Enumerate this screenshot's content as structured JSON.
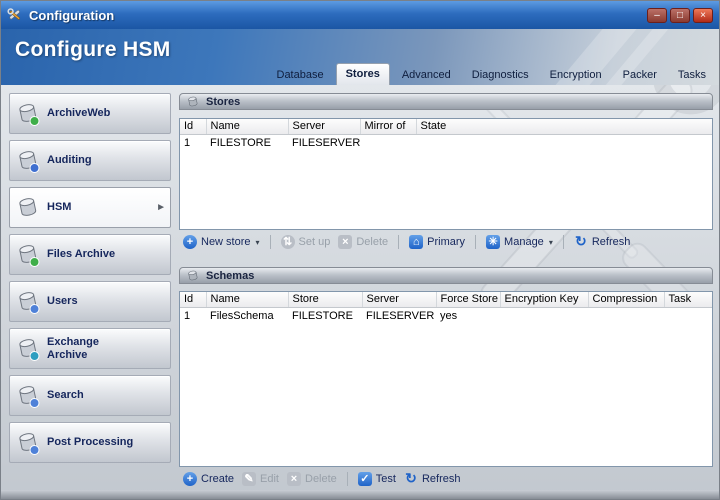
{
  "window": {
    "title": "Configuration"
  },
  "header": {
    "title": "Configure HSM"
  },
  "tabs": [
    {
      "label": "Database",
      "active": false
    },
    {
      "label": "Stores",
      "active": true
    },
    {
      "label": "Advanced",
      "active": false
    },
    {
      "label": "Diagnostics",
      "active": false
    },
    {
      "label": "Encryption",
      "active": false
    },
    {
      "label": "Packer",
      "active": false
    },
    {
      "label": "Tasks",
      "active": false
    }
  ],
  "sidebar": {
    "items": [
      {
        "label": "ArchiveWeb",
        "accent": "#3fae49"
      },
      {
        "label": "Auditing",
        "accent": "#3f6fd0"
      },
      {
        "label": "HSM",
        "accent": "#8d949e"
      },
      {
        "label": "Files Archive",
        "accent": "#3fae49"
      },
      {
        "label": "Users",
        "accent": "#4f81d8"
      },
      {
        "label": "Exchange\nArchive",
        "accent": "#2e9ec0"
      },
      {
        "label": "Search",
        "accent": "#4f81d8"
      },
      {
        "label": "Post Processing",
        "accent": "#4f81d8"
      }
    ]
  },
  "stores": {
    "title": "Stores",
    "columns": [
      "Id",
      "Name",
      "Server",
      "Mirror of",
      "State"
    ],
    "rows": [
      [
        "1",
        "FILESTORE",
        "FILESERVER",
        "",
        ""
      ]
    ],
    "toolbar": {
      "new_store": "New store",
      "set_up": "Set up",
      "delete": "Delete",
      "primary": "Primary",
      "manage": "Manage",
      "refresh": "Refresh"
    }
  },
  "schemas": {
    "title": "Schemas",
    "columns": [
      "Id",
      "Name",
      "Store",
      "Server",
      "Force Store",
      "Encryption Key",
      "Compression",
      "Task"
    ],
    "rows": [
      [
        "1",
        "FilesSchema",
        "FILESTORE",
        "FILESERVER",
        "yes",
        "",
        "",
        ""
      ]
    ],
    "toolbar": {
      "create": "Create",
      "edit": "Edit",
      "delete": "Delete",
      "test": "Test",
      "refresh": "Refresh"
    }
  },
  "icons": {
    "add": "+",
    "setup": "⇅",
    "delete": "×",
    "home": "⌂",
    "manage": "✳",
    "refresh": "↻",
    "edit": "✎",
    "test": "✓",
    "caret": "▾",
    "arrow": "►",
    "min": "–",
    "max": "□",
    "close": "×"
  }
}
